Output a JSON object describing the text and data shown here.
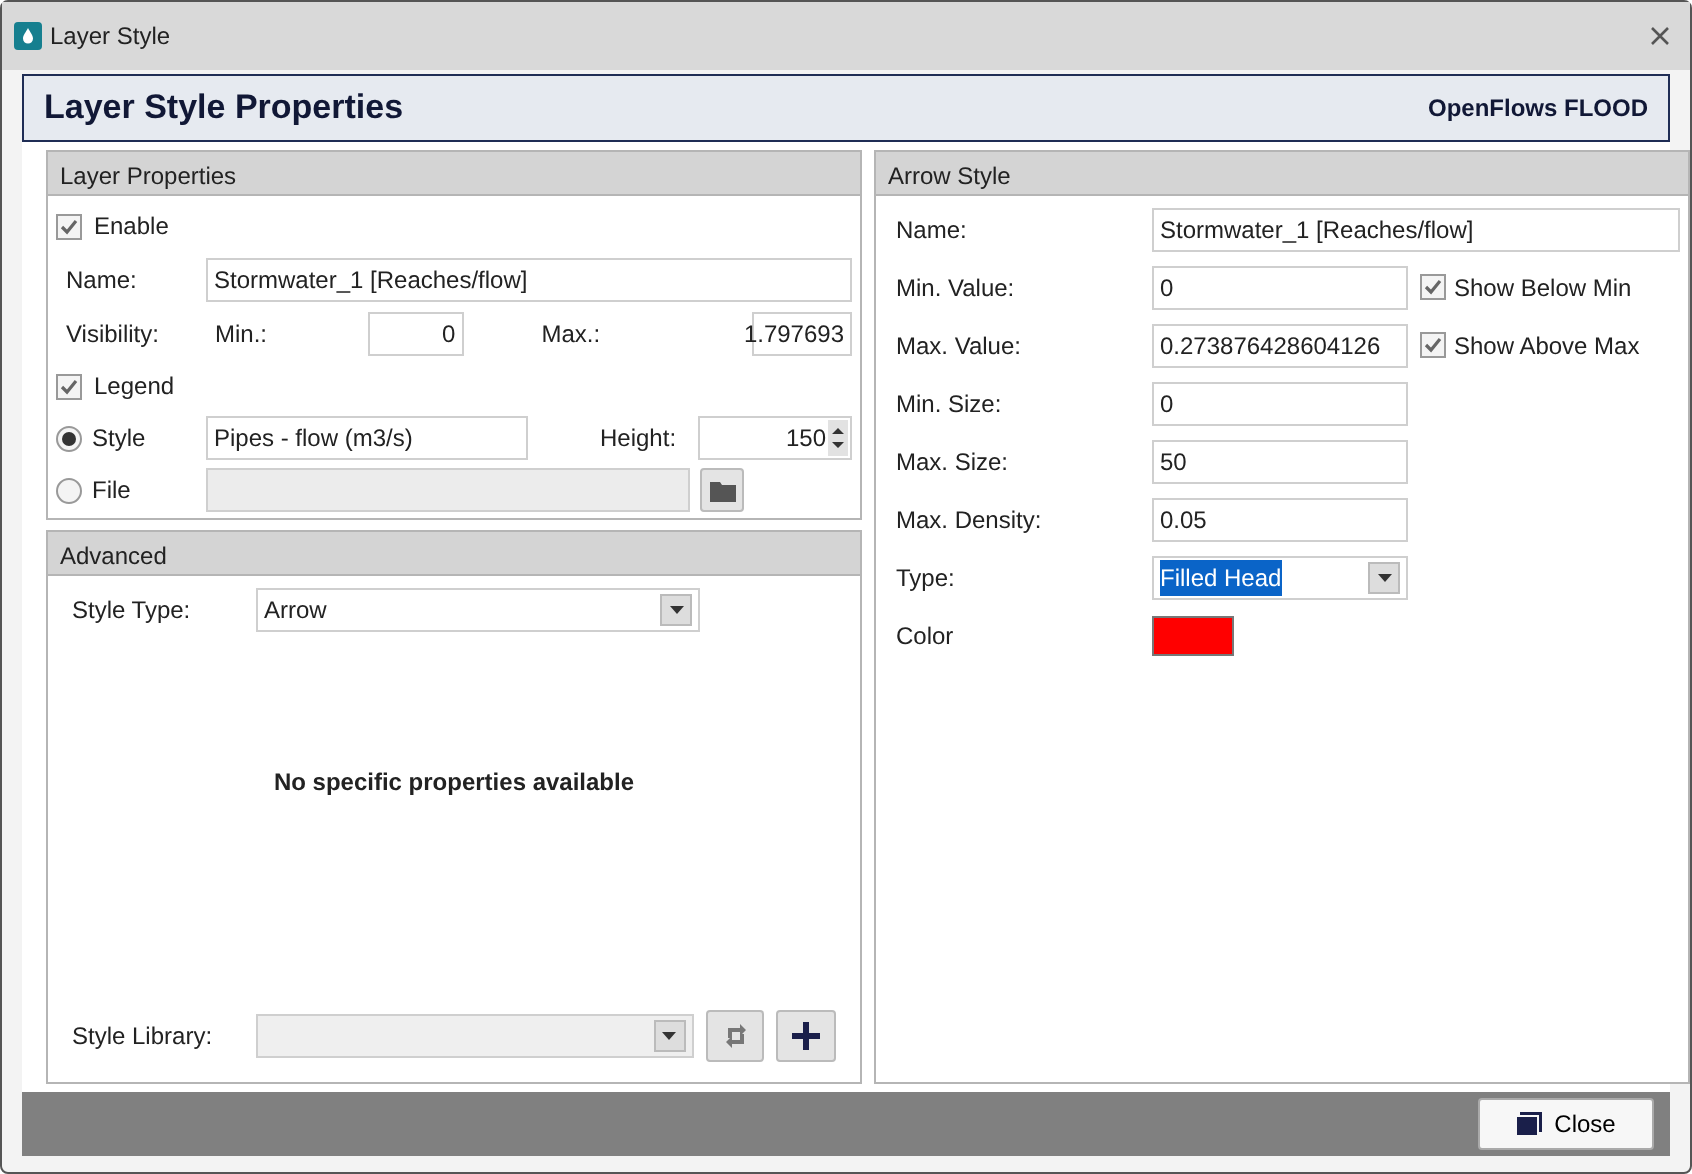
{
  "window": {
    "title": "Layer Style"
  },
  "header": {
    "title": "Layer Style Properties",
    "brand": "OpenFlows FLOOD"
  },
  "layer_properties": {
    "title": "Layer Properties",
    "enable": {
      "label": "Enable",
      "checked": true
    },
    "name": {
      "label": "Name:",
      "value": "Stormwater_1 [Reaches/flow]"
    },
    "visibility": {
      "label": "Visibility:",
      "min_label": "Min.:",
      "min_value": "0",
      "max_label": "Max.:",
      "max_value": "1.797693"
    },
    "legend": {
      "label": "Legend",
      "checked": true
    },
    "style_option": {
      "label": "Style",
      "selected": true,
      "value": "Pipes - flow (m3/s)"
    },
    "height": {
      "label": "Height:",
      "value": "150"
    },
    "file_option": {
      "label": "File",
      "selected": false
    }
  },
  "advanced": {
    "title": "Advanced",
    "style_type": {
      "label": "Style Type:",
      "value": "Arrow"
    },
    "message": "No specific properties available",
    "style_library": {
      "label": "Style Library:"
    }
  },
  "arrow_style": {
    "title": "Arrow Style",
    "fields": [
      {
        "kind": "wide",
        "label": "Name:",
        "value": "Stormwater_1 [Reaches/flow]"
      },
      {
        "kind": "check",
        "label": "Min. Value:",
        "value": "0",
        "check_label": "Show Below Min",
        "checked": true
      },
      {
        "kind": "check",
        "label": "Max. Value:",
        "value": "0.273876428604126",
        "check_label": "Show Above Max",
        "checked": true
      },
      {
        "kind": "text",
        "label": "Min. Size:",
        "value": "0"
      },
      {
        "kind": "text",
        "label": "Max. Size:",
        "value": "50"
      },
      {
        "kind": "text",
        "label": "Max. Density:",
        "value": "0.05"
      },
      {
        "kind": "select",
        "label": "Type:",
        "value": "Filled Head"
      },
      {
        "kind": "color",
        "label": "Color",
        "color": "#ff0000"
      }
    ]
  },
  "footer": {
    "close_label": "Close"
  }
}
